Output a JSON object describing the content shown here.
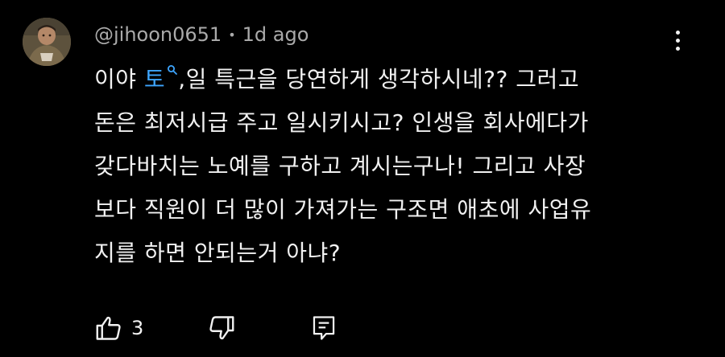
{
  "comment": {
    "author": "@jihoon0651",
    "separator": "•",
    "time": "1d ago",
    "lines": [
      {
        "before": "이야 ",
        "mention": "토",
        "after": ",일 특근을 당연하게 생각하시네?? 그러고"
      },
      {
        "text": "돈은 최저시급 주고 일시키시고? 인생을 회사에다가"
      },
      {
        "text": "갖다바치는 노예를 구하고 계시는구나! 그리고 사장"
      },
      {
        "text": "보다 직원이 더 많이 가져가는 구조면 애초에 사업유"
      },
      {
        "text": "지를 하면 안되는거 아냐?"
      }
    ],
    "like_count": "3"
  },
  "colors": {
    "background": "#000000",
    "text": "#f1f1f1",
    "meta": "#aaaaaa",
    "mention": "#3ea6ff"
  },
  "icons": {
    "avatar": "user-avatar-photo",
    "more": "more-vert-icon",
    "like": "thumb-up-icon",
    "dislike": "thumb-down-icon",
    "reply": "reply-comment-icon",
    "mention_search": "search-icon"
  }
}
